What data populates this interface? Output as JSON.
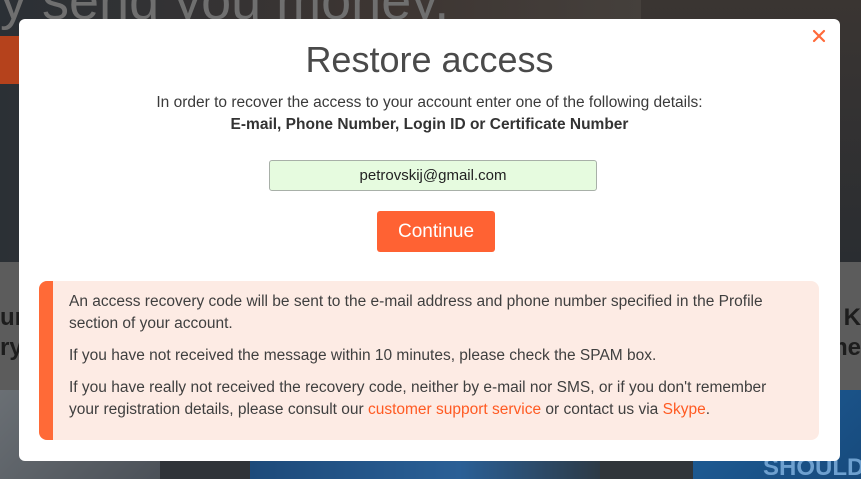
{
  "background": {
    "headline": "y send you money.",
    "left_fragment": "ur\nry",
    "right_fragment": "K\nme",
    "tile_fragment": "SHOULD"
  },
  "modal": {
    "close_icon": "close-icon",
    "title": "Restore access",
    "subtitle": "In order to recover the access to your account enter one of the following details:",
    "details": "E-mail, Phone Number, Login ID or Certificate Number",
    "input_value": "petrovskij@gmail.com",
    "continue_label": "Continue",
    "notice": {
      "p1": "An access recovery code will be sent to the e-mail address and phone number specified in the Profile section of your account.",
      "p2": "If you have not received the message within 10 minutes, please check the SPAM box.",
      "p3_before": "If you have really not received the recovery code, neither by e-mail nor SMS, or if you don't remember your registration details, please consult our ",
      "support_link": "customer support service",
      "p3_middle": " or contact us via ",
      "skype_link": "Skype",
      "p3_after": "."
    }
  },
  "colors": {
    "accent": "#ff6233",
    "input_bg": "#e6fbdf",
    "notice_bg": "#fdebe4"
  }
}
